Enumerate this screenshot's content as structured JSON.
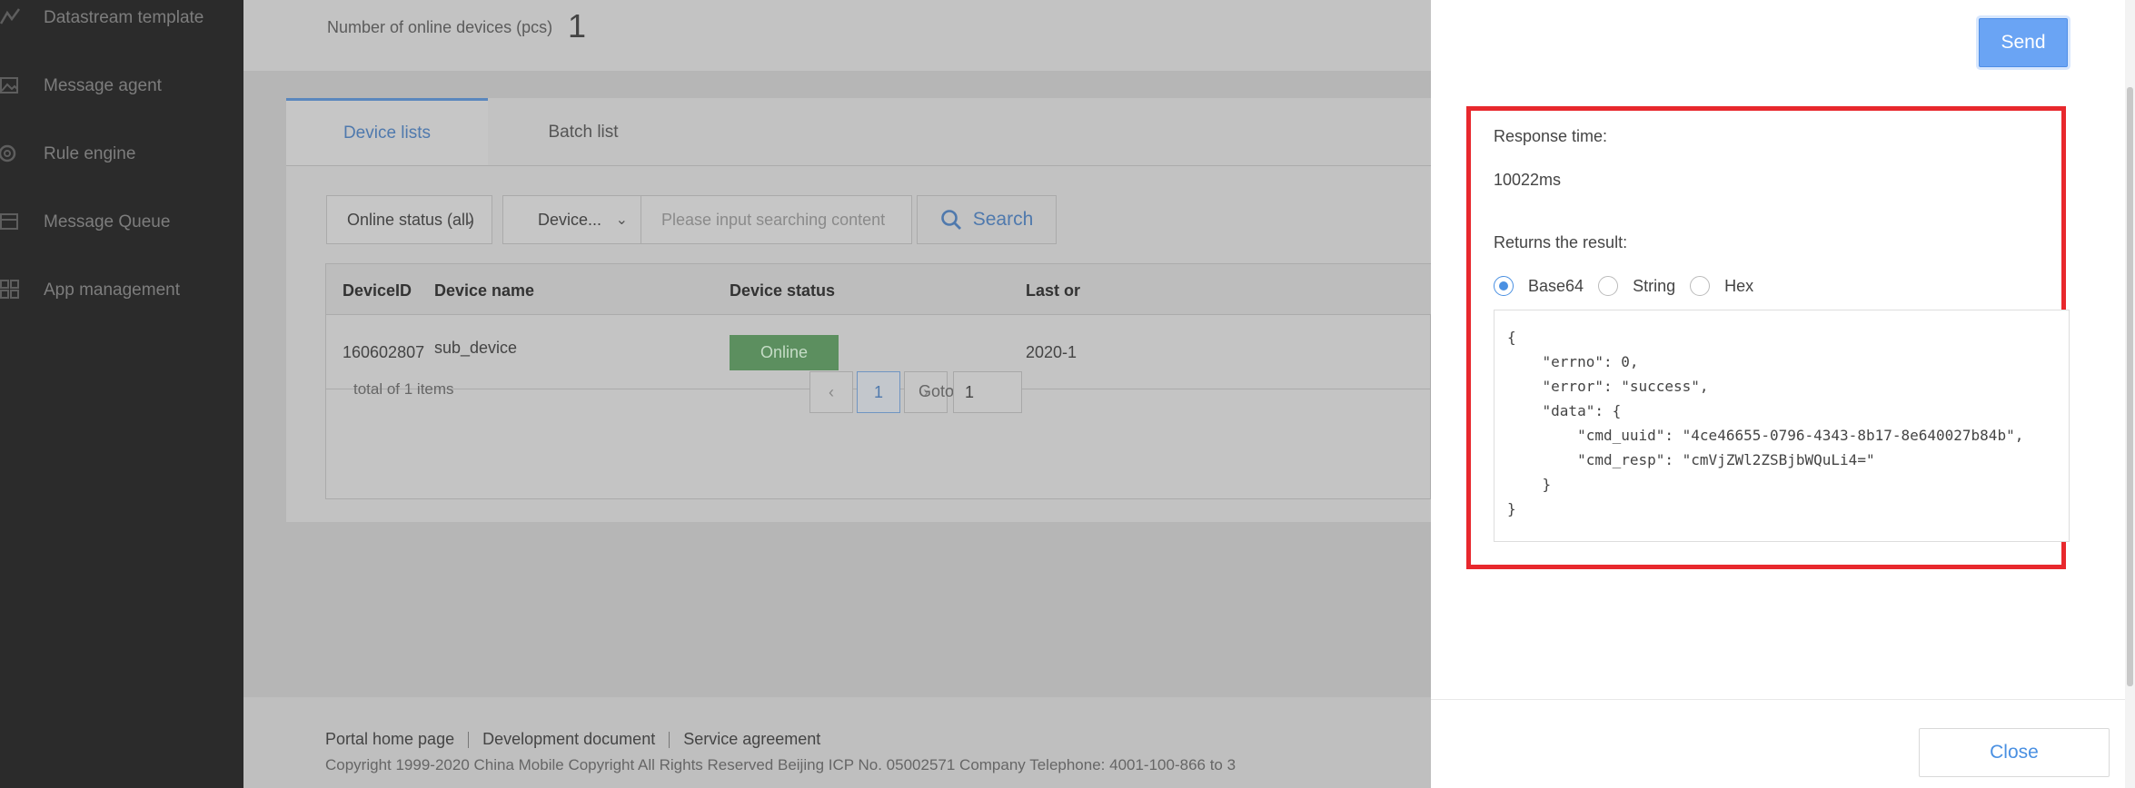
{
  "sidebar": {
    "items": [
      {
        "label": "Datastream template",
        "icon": "chart-line-icon"
      },
      {
        "label": "Message agent",
        "icon": "image-icon"
      },
      {
        "label": "Rule engine",
        "icon": "gear-icon"
      },
      {
        "label": "Message Queue",
        "icon": "queue-icon"
      },
      {
        "label": "App management",
        "icon": "grid-icon"
      }
    ]
  },
  "header": {
    "online_label": "Number of online devices (pcs)",
    "online_value": "1"
  },
  "tabs": [
    {
      "label": "Device lists",
      "active": true
    },
    {
      "label": "Batch list",
      "active": false
    }
  ],
  "filters": {
    "status_value": "Online status (all)",
    "field_value": "Device...",
    "search_placeholder": "Please input searching content",
    "search_label": "Search"
  },
  "table": {
    "headers": [
      "DeviceID",
      "Device name",
      "Device status",
      "Last or"
    ],
    "rows": [
      {
        "id": "160602807",
        "name": "sub_device",
        "status": "Online",
        "last": "2020-1"
      }
    ],
    "total": "total of 1 items",
    "page": "1",
    "goto_label": "Goto",
    "goto_value": "1"
  },
  "footer": {
    "links": [
      "Portal home page",
      "Development document",
      "Service agreement"
    ],
    "copyright": "Copyright 1999-2020 China Mobile Copyright All Rights Reserved Beijing ICP No. 05002571 Company Telephone: 4001-100-866 to 3"
  },
  "drawer": {
    "send_label": "Send",
    "response_time_label": "Response time:",
    "response_time_value": "10022ms",
    "result_label": "Returns the result:",
    "formats": [
      "Base64",
      "String",
      "Hex"
    ],
    "selected_format": "Base64",
    "result_text": "{\n    \"errno\": 0,\n    \"error\": \"success\",\n    \"data\": {\n        \"cmd_uuid\": \"4ce46655-0796-4343-8b17-8e640027b84b\",\n        \"cmd_resp\": \"cmVjZWl2ZSBjbWQuLi4=\"\n    }\n}",
    "close_label": "Close"
  },
  "colors": {
    "accent": "#4a90e2",
    "online_badge": "#5c8f5f",
    "highlight_border": "#e8282d"
  }
}
